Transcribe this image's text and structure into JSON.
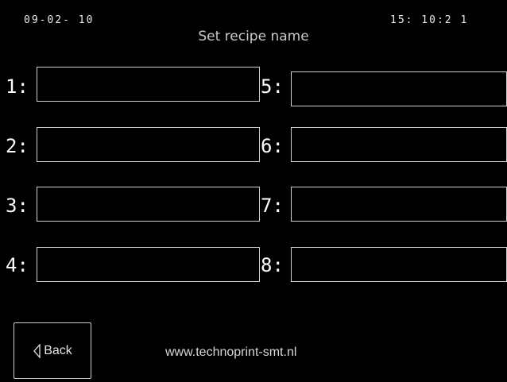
{
  "header": {
    "date": "09-02- 10",
    "time": "15: 10:2 1",
    "title": "Set recipe name"
  },
  "slots": [
    {
      "label": "1:",
      "value": ""
    },
    {
      "label": "2:",
      "value": ""
    },
    {
      "label": "3:",
      "value": ""
    },
    {
      "label": "4:",
      "value": ""
    },
    {
      "label": "5:",
      "value": ""
    },
    {
      "label": "6:",
      "value": ""
    },
    {
      "label": "7:",
      "value": ""
    },
    {
      "label": "8:",
      "value": ""
    }
  ],
  "back_button": {
    "label": "Back",
    "icon": "chevron-left-icon"
  },
  "footer": {
    "url": "www.technoprint-smt.nl"
  },
  "colors": {
    "background": "#000000",
    "foreground": "#ffffff",
    "border": "#cfcfcf"
  }
}
